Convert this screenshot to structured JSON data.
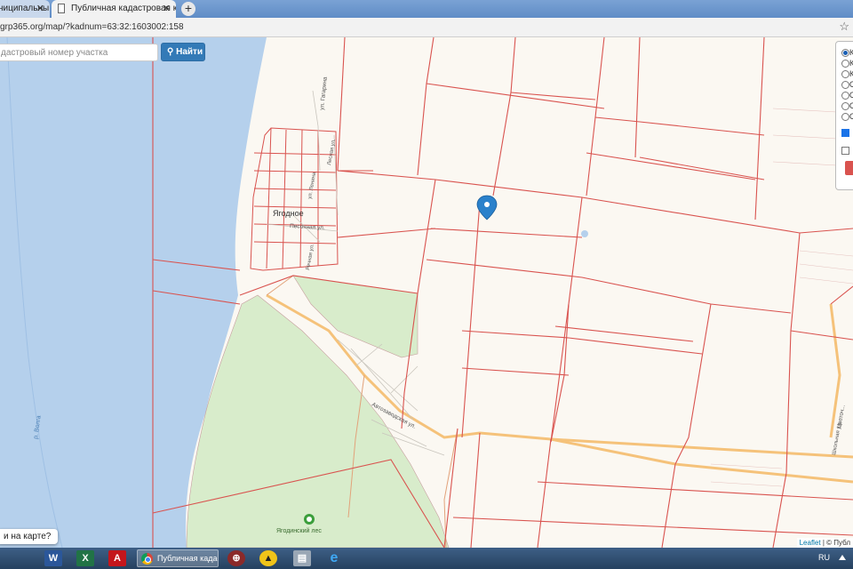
{
  "browser": {
    "tabs": [
      {
        "label": "ниципальны",
        "active": false
      },
      {
        "label": "Публичная кадастровая карта",
        "active": true
      }
    ],
    "new_tab_label": "+",
    "close_glyph": "✕",
    "url": "grp365.org/map/?kadnum=63:32:1603002:158",
    "bookmark_icon": "star-icon"
  },
  "search": {
    "placeholder": "дастровый номер участка",
    "button_label": "Найти",
    "button_icon": "search-icon"
  },
  "map": {
    "place_labels": {
      "village": "Ягодное",
      "forest": "Ягодинский лес",
      "river": "р. Волга"
    },
    "street_labels": {
      "gagarina": "ул. Гагарина",
      "pesochnaya": "Песочная ул.",
      "avtozavodskaya": "Автозаводская ул.",
      "tsvetochnaya": "Цветоч...",
      "lenina": "ул. Ленина",
      "rechnaya": "Речная ул.",
      "lesnaya": "Лесная ул.",
      "shkolnaya": "Школьная ул."
    },
    "popup_button": "и на карте?",
    "attribution": {
      "leaflet": "Leaflet",
      "rest": " | © Публ"
    },
    "colors": {
      "water": "#b5d0ec",
      "land": "#fbf8f2",
      "forest": "#d8eccb",
      "parcel_border": "#d9534f",
      "road": "#f5c27a",
      "marker": "#2a81cb"
    }
  },
  "layers_panel": {
    "radio_letters": [
      "К",
      "К",
      "К",
      "С",
      "С",
      "С",
      "С"
    ],
    "checkbox_letters": [
      "",
      ""
    ]
  },
  "taskbar": {
    "icons": [
      "word-icon",
      "excel-icon",
      "pdf-icon",
      "chrome-icon",
      "browser-icon",
      "app-icon",
      "network-icon",
      "ie-icon"
    ],
    "chrome_task_label": "Публичная кадас...",
    "language": "RU"
  }
}
